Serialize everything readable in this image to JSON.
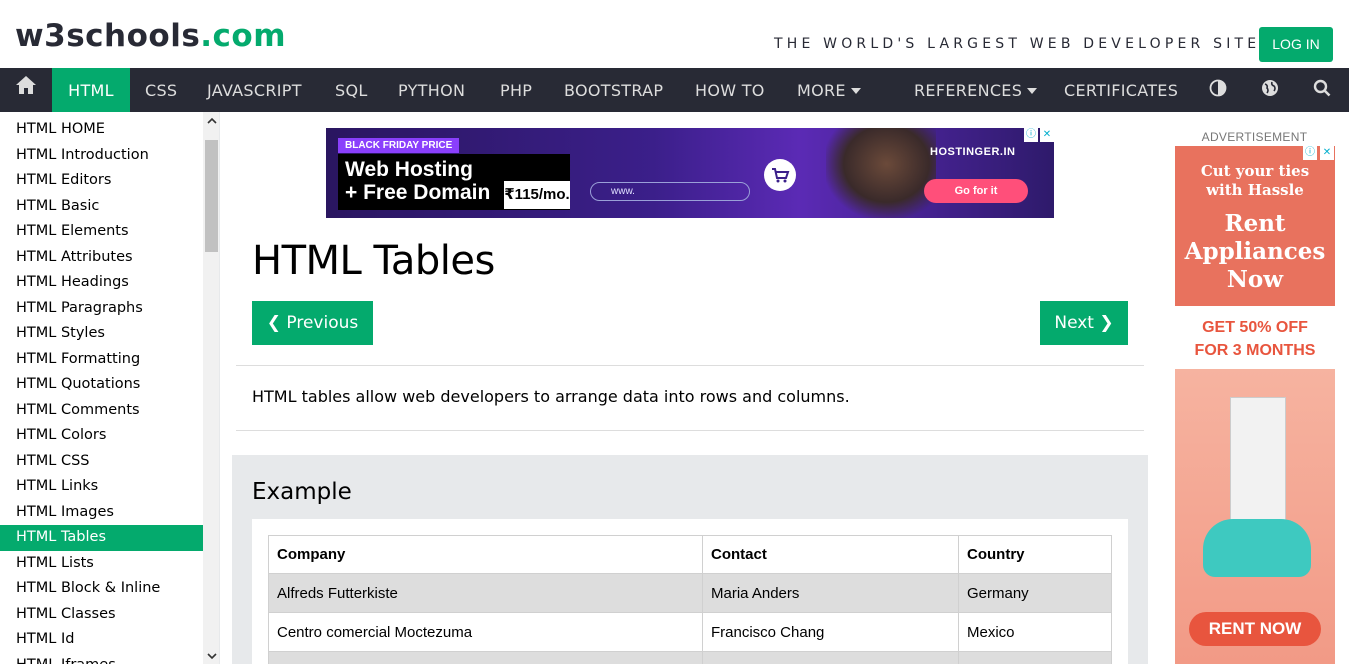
{
  "header": {
    "logo_main": "w3schools",
    "logo_suffix": ".com",
    "tagline": "THE WORLD'S LARGEST WEB DEVELOPER SITE",
    "login_label": "LOG IN"
  },
  "nav": {
    "home_icon": "home-icon",
    "items": [
      "HTML",
      "CSS",
      "JAVASCRIPT",
      "SQL",
      "PYTHON",
      "PHP",
      "BOOTSTRAP",
      "HOW TO",
      "MORE",
      "REFERENCES",
      "CERTIFICATES"
    ],
    "active": "HTML",
    "icons": [
      "contrast-icon",
      "globe-icon",
      "search-icon"
    ]
  },
  "sidebar": {
    "items": [
      "HTML HOME",
      "HTML Introduction",
      "HTML Editors",
      "HTML Basic",
      "HTML Elements",
      "HTML Attributes",
      "HTML Headings",
      "HTML Paragraphs",
      "HTML Styles",
      "HTML Formatting",
      "HTML Quotations",
      "HTML Comments",
      "HTML Colors",
      "HTML CSS",
      "HTML Links",
      "HTML Images",
      "HTML Tables",
      "HTML Lists",
      "HTML Block & Inline",
      "HTML Classes",
      "HTML Id",
      "HTML Iframes"
    ],
    "active": "HTML Tables"
  },
  "banner_ad": {
    "badge": "BLACK FRIDAY PRICE",
    "headline_1": "Web Hosting",
    "headline_2": "+ Free Domain",
    "price": "₹115/mo.",
    "url_text": "www.",
    "brand": "HOSTINGER.IN",
    "cta": "Go for it"
  },
  "main": {
    "title": "HTML Tables",
    "prev_label": "❮ Previous",
    "next_label": "Next ❯",
    "intro": "HTML tables allow web developers to arrange data into rows and columns.",
    "example_heading": "Example",
    "table": {
      "headers": [
        "Company",
        "Contact",
        "Country"
      ],
      "rows": [
        [
          "Alfreds Futterkiste",
          "Maria Anders",
          "Germany"
        ],
        [
          "Centro comercial Moctezuma",
          "Francisco Chang",
          "Mexico"
        ]
      ]
    }
  },
  "right_ad": {
    "label": "ADVERTISEMENT",
    "line_cut_1": "Cut your ties",
    "line_cut_2": "with Hassle",
    "rent_1": "Rent",
    "rent_2": "Appliances",
    "rent_3": "Now",
    "offer_1": "GET 50% OFF",
    "offer_2": "FOR 3 MONTHS",
    "cta": "RENT NOW"
  },
  "colors": {
    "brand_green": "#04AA6D",
    "nav_bg": "#282A35",
    "example_bg": "#E7E9EB"
  }
}
